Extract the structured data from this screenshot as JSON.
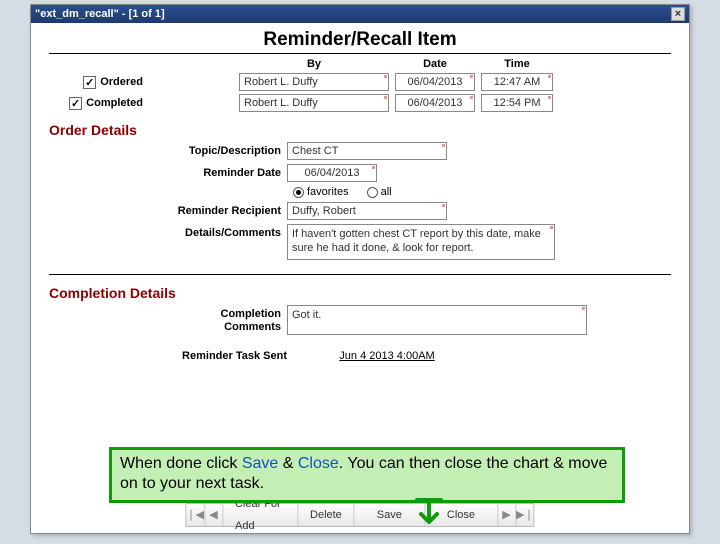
{
  "titlebar": {
    "text": "\"ext_dm_recall\" - [1 of 1]",
    "close": "×"
  },
  "main_title": "Reminder/Recall Item",
  "col_headers": {
    "by": "By",
    "date": "Date",
    "time": "Time"
  },
  "statuses": {
    "ordered": {
      "label": "Ordered",
      "checked": true,
      "by": "Robert L. Duffy",
      "date": "06/04/2013",
      "time": "12:47 AM"
    },
    "completed": {
      "label": "Completed",
      "checked": true,
      "by": "Robert L. Duffy",
      "date": "06/04/2013",
      "time": "12:54 PM"
    }
  },
  "sections": {
    "order": "Order Details",
    "completion": "Completion Details"
  },
  "order": {
    "topic_label": "Topic/Description",
    "topic_value": "Chest CT",
    "reminder_date_label": "Reminder Date",
    "reminder_date_value": "06/04/2013",
    "radio_favorites": "favorites",
    "radio_all": "all",
    "recipient_label": "Reminder Recipient",
    "recipient_value": "Duffy, Robert",
    "details_label": "Details/Comments",
    "details_value": "If haven't gotten chest CT report by this date, make sure he had it done, & look for report."
  },
  "completion": {
    "comments_label": "Completion Comments",
    "comments_value": "Got it.",
    "task_sent_label": "Reminder Task Sent",
    "task_sent_value": "Jun  4 2013  4:00AM"
  },
  "instruction": {
    "p1a": "When done click ",
    "save": "Save",
    "amp": " & ",
    "close": "Close",
    "p1b": ".  You can then close the chart & move on to your next task."
  },
  "toolbar": {
    "first": "❘◀",
    "prev": "◀",
    "clear": "Clear For Add",
    "delete": "Delete",
    "save": "Save",
    "close": "Close",
    "next": "▶",
    "last": "▶❘"
  }
}
